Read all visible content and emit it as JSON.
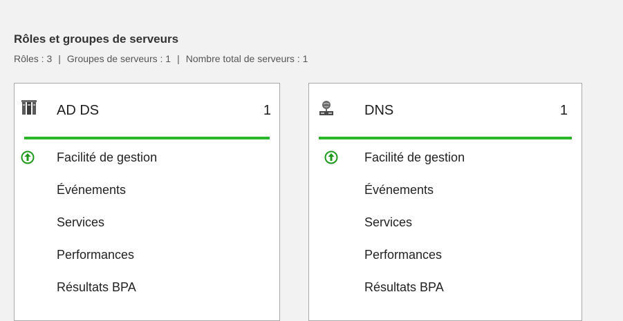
{
  "section": {
    "title": "Rôles et groupes de serveurs",
    "roles_count": "Rôles : 3",
    "groups_count": "Groupes de serveurs : 1",
    "servers_total": "Nombre total de serveurs : 1",
    "separator": "|"
  },
  "tiles": [
    {
      "name": "AD DS",
      "count": "1",
      "icon": "ad-ds-icon",
      "status_color": "#2bb52b",
      "metrics": [
        "Facilité de gestion",
        "Événements",
        "Services",
        "Performances",
        "Résultats BPA"
      ]
    },
    {
      "name": "DNS",
      "count": "1",
      "icon": "dns-server-icon",
      "status_color": "#2bb52b",
      "metrics": [
        "Facilité de gestion",
        "Événements",
        "Services",
        "Performances",
        "Résultats BPA"
      ]
    }
  ]
}
